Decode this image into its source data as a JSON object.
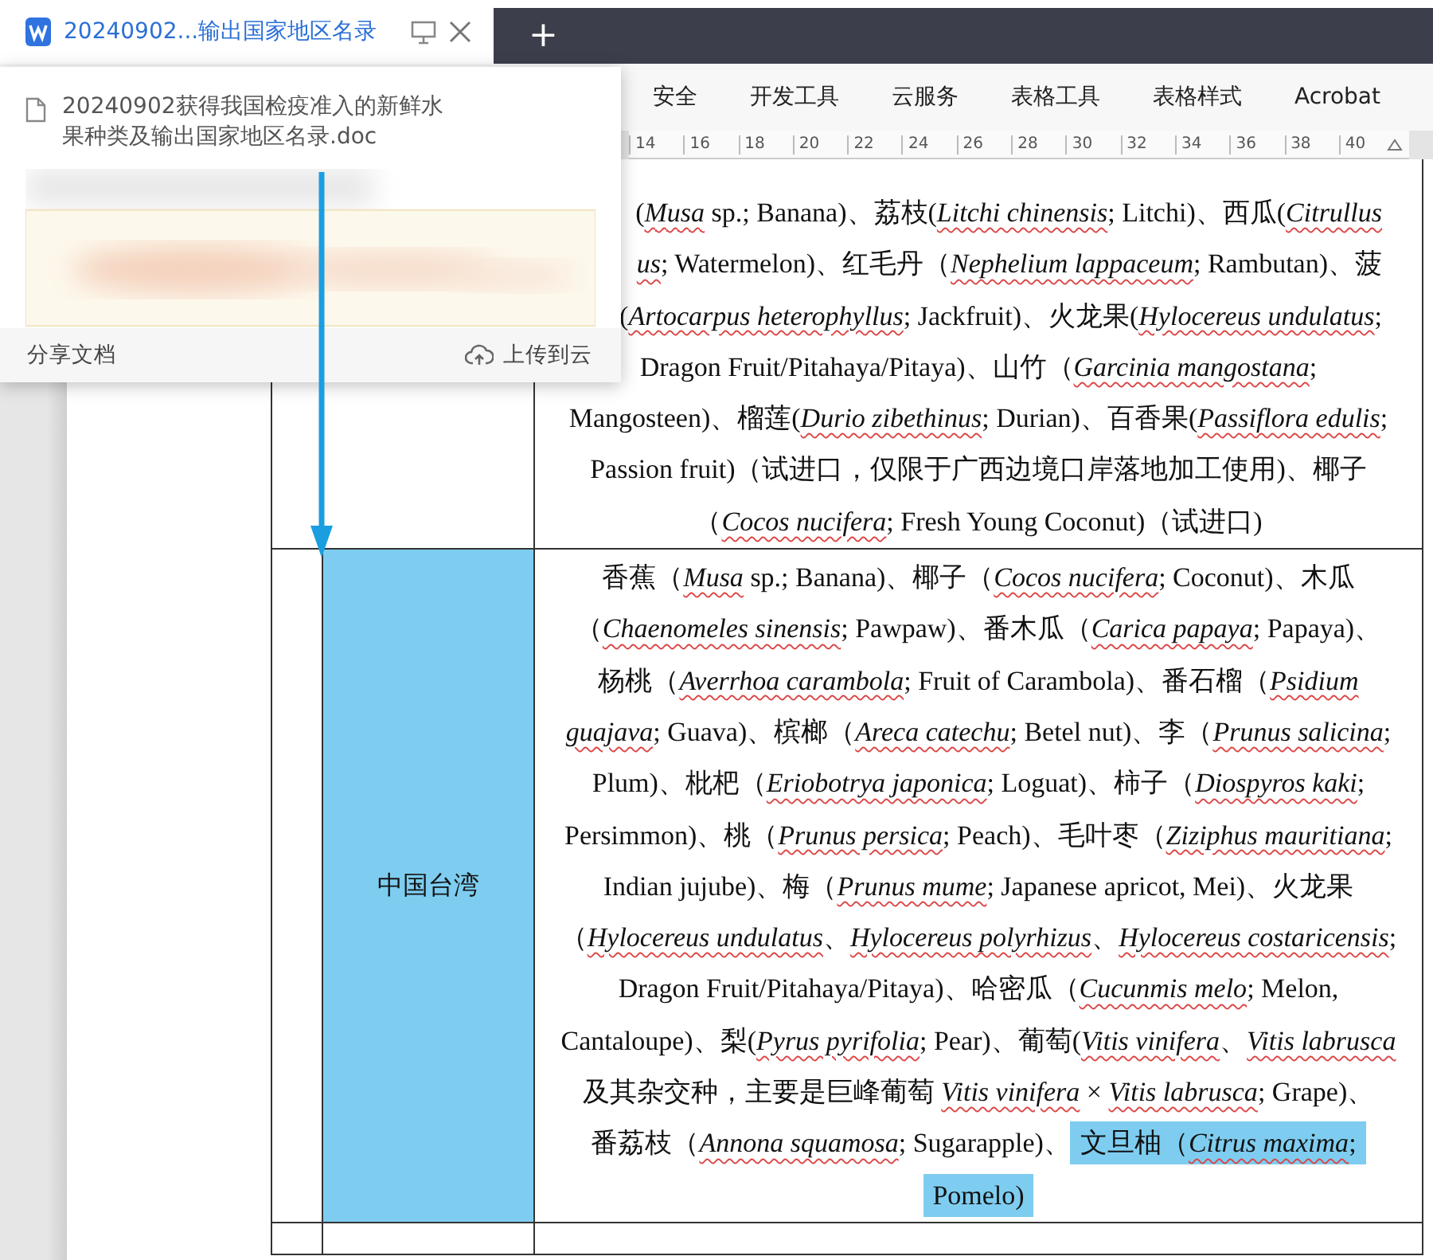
{
  "tab": {
    "title": "20240902...输出国家地区名录",
    "selected": true
  },
  "new_tab": "+",
  "ribbon_tabs": [
    "安全",
    "开发工具",
    "云服务",
    "表格工具",
    "表格样式",
    "Acrobat"
  ],
  "ruler": [
    "14",
    "16",
    "18",
    "20",
    "22",
    "24",
    "26",
    "28",
    "30",
    "32",
    "34",
    "36",
    "38",
    "40"
  ],
  "popup": {
    "filename": "20240902获得我国检疫准入的新鲜水果种类及输出国家地区名录.doc",
    "share": "分享文档",
    "upload": "上传到云"
  },
  "table": {
    "rows": [
      {
        "lines": [
          {
            "text": "(*Musa* sp.; Banana)、荔枝(*Litchi chinensis*; Litchi)、西瓜(*Citrullus*",
            "clipped": true
          },
          {
            "text": "*us*; Watermelon)、红毛丹（*Nephelium lappaceum*; Rambutan)、菠",
            "clipped": true
          },
          {
            "text": "(*Artocarpus heterophyllus*; Jackfruit)、火龙果(*Hylocereus undulatus*;",
            "clipped": true
          },
          {
            "text": "Dragon Fruit/Pitahaya/Pitaya)、山竹（*Garcinia mangostana*;",
            "clipped": false
          },
          {
            "text": "Mangosteen)、榴莲(*Durio zibethinus*; Durian)、百香果(*Passiflora edulis*;",
            "clipped": false
          },
          {
            "text": "Passion fruit)（试进口，仅限于广西边境口岸落地加工使用)、椰子",
            "clipped": false
          },
          {
            "text": "（*Cocos nucifera*; Fresh Young Coconut)（试进口)",
            "clipped": false
          }
        ]
      },
      {
        "region": "中国台湾",
        "highlighted": true,
        "lines": [
          {
            "text": "香蕉（*Musa* sp.; Banana)、椰子（*Cocos nucifera*; Coconut)、木瓜",
            "clipped": false
          },
          {
            "text": "（*Chaenomeles sinensis*; Pawpaw)、番木瓜（*Carica papaya*; Papaya)、",
            "clipped": false
          },
          {
            "text": "杨桃（*Averrhoa carambola*; Fruit of Carambola)、番石榴（*Psidium*",
            "clipped": false
          },
          {
            "text": "*guajava*; Guava)、槟榔（*Areca catechu*; Betel nut)、李（*Prunus salicina*;",
            "clipped": false
          },
          {
            "text": "Plum)、枇杷（*Eriobotrya japonica*; Loguat)、柿子（*Diospyros kaki*;",
            "clipped": false
          },
          {
            "text": "Persimmon)、桃（*Prunus persica*; Peach)、毛叶枣（*Ziziphus mauritiana*;",
            "clipped": false
          },
          {
            "text": "Indian jujube)、梅（*Prunus mume*; Japanese apricot, Mei)、火龙果",
            "clipped": false
          },
          {
            "text": "（*Hylocereus undulatus*、*Hylocereus polyrhizus*、*Hylocereus costaricensis*;",
            "clipped": false
          },
          {
            "text": "Dragon Fruit/Pitahaya/Pitaya)、哈密瓜（*Cucunmis melo*; Melon,",
            "clipped": false
          },
          {
            "text": "Cantaloupe)、梨(*Pyrus pyrifolia*; Pear)、葡萄(*Vitis vinifera*、*Vitis labrusca*",
            "clipped": false
          },
          {
            "text": "及其杂交种，主要是巨峰葡萄 *Vitis vinifera* × *Vitis labrusca*; Grape)、",
            "clipped": false
          },
          {
            "text": "番荔枝（*Annona squamosa*; Sugarapple)、",
            "highlight": "文旦柚（*Citrus maxima*;",
            "clipped": false
          },
          {
            "highlight": "Pomelo)",
            "clipped": false
          }
        ]
      }
    ]
  }
}
